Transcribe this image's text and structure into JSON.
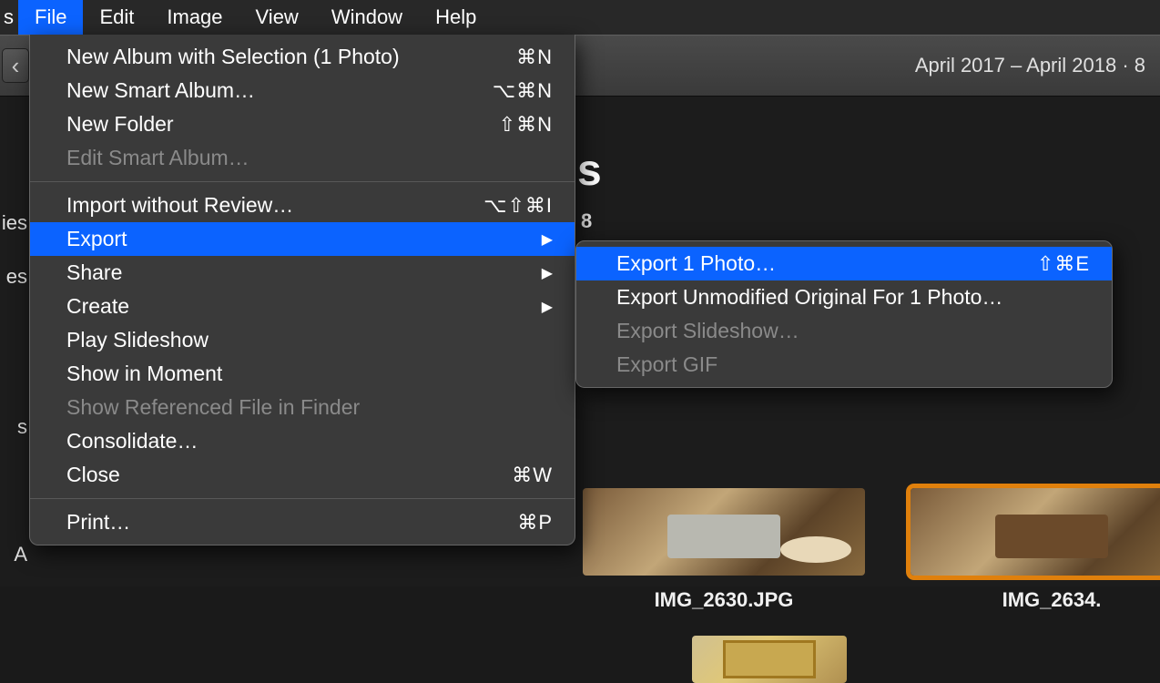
{
  "menubar": {
    "left_stub": "s",
    "items": [
      "File",
      "Edit",
      "Image",
      "View",
      "Window",
      "Help"
    ],
    "active_index": 0
  },
  "toolbar": {
    "back_glyph": "‹",
    "right_text": "April 2017 – April 2018 · 8"
  },
  "sidebar": {
    "s1": "ies",
    "s2": "es",
    "s3": "s",
    "s4": "A"
  },
  "content": {
    "title_fragment": "s",
    "subtitle_fragment": "8"
  },
  "file_menu": {
    "items": [
      {
        "label": "New Album with Selection (1 Photo)",
        "shortcut": "⌘N",
        "enabled": true
      },
      {
        "label": "New Smart Album…",
        "shortcut": "⌥⌘N",
        "enabled": true
      },
      {
        "label": "New Folder",
        "shortcut": "⇧⌘N",
        "enabled": true
      },
      {
        "label": "Edit Smart Album…",
        "shortcut": "",
        "enabled": false
      },
      {
        "sep": true
      },
      {
        "label": "Import without Review…",
        "shortcut": "⌥⇧⌘I",
        "enabled": true
      },
      {
        "label": "Export",
        "shortcut": "",
        "enabled": true,
        "submenu": true,
        "highlighted": true
      },
      {
        "label": "Share",
        "shortcut": "",
        "enabled": true,
        "submenu": true
      },
      {
        "label": "Create",
        "shortcut": "",
        "enabled": true,
        "submenu": true
      },
      {
        "label": "Play Slideshow",
        "shortcut": "",
        "enabled": true
      },
      {
        "label": "Show in Moment",
        "shortcut": "",
        "enabled": true
      },
      {
        "label": "Show Referenced File in Finder",
        "shortcut": "",
        "enabled": false
      },
      {
        "label": "Consolidate…",
        "shortcut": "",
        "enabled": true
      },
      {
        "label": "Close",
        "shortcut": "⌘W",
        "enabled": true
      },
      {
        "sep": true
      },
      {
        "label": "Print…",
        "shortcut": "⌘P",
        "enabled": true
      }
    ]
  },
  "export_submenu": {
    "items": [
      {
        "label": "Export 1 Photo…",
        "shortcut": "⇧⌘E",
        "enabled": true,
        "highlighted": true
      },
      {
        "label": "Export Unmodified Original For 1 Photo…",
        "shortcut": "",
        "enabled": true
      },
      {
        "label": "Export Slideshow…",
        "shortcut": "",
        "enabled": false
      },
      {
        "label": "Export GIF",
        "shortcut": "",
        "enabled": false
      }
    ]
  },
  "thumbnails": [
    {
      "label": "IMG_2630.JPG",
      "selected": false
    },
    {
      "label": "IMG_2634.",
      "selected": true
    }
  ]
}
